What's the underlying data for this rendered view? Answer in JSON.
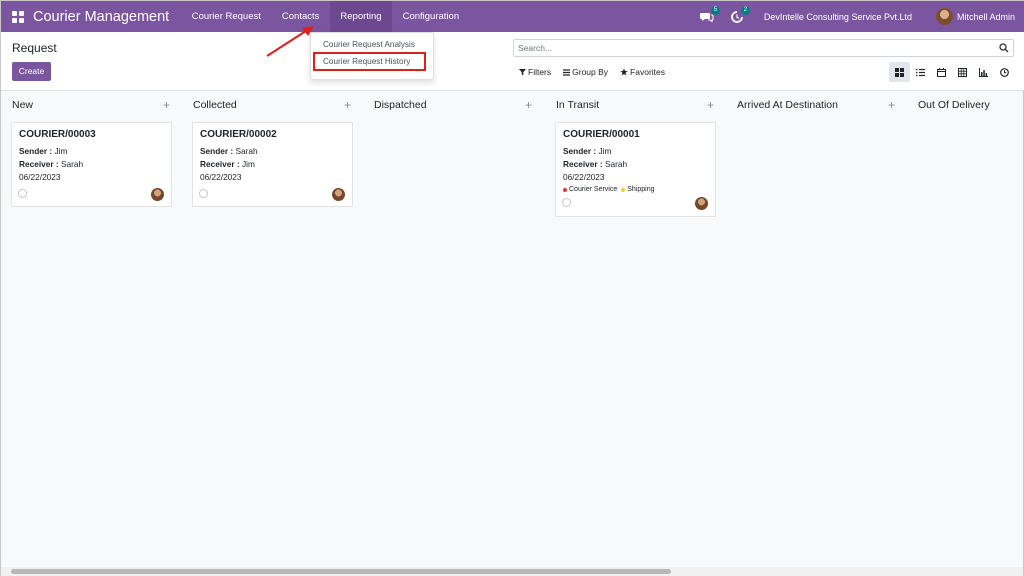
{
  "navbar": {
    "brand": "Courier Management",
    "menu": [
      "Courier Request",
      "Contacts",
      "Reporting",
      "Configuration"
    ],
    "messages_count": "5",
    "activities_count": "2",
    "company": "DevIntelle Consulting Service Pvt.Ltd",
    "user": "Mitchell Admin"
  },
  "dropdown": {
    "items": [
      "Courier Request Analysis",
      "Courier Request History"
    ]
  },
  "control": {
    "title": "Request",
    "create_label": "Create",
    "search_placeholder": "Search...",
    "filters_label": "Filters",
    "group_by_label": "Group By",
    "favorites_label": "Favorites"
  },
  "kanban": {
    "columns": [
      {
        "title": "New",
        "cards": [
          {
            "ref": "COURIER/00003",
            "sender_label": "Sender :",
            "sender": "Jim",
            "receiver_label": "Receiver :",
            "receiver": "Sarah",
            "date": "06/22/2023"
          }
        ]
      },
      {
        "title": "Collected",
        "cards": [
          {
            "ref": "COURIER/00002",
            "sender_label": "Sender :",
            "sender": "Sarah",
            "receiver_label": "Receiver :",
            "receiver": "Jim",
            "date": "06/22/2023"
          }
        ]
      },
      {
        "title": "Dispatched",
        "cards": []
      },
      {
        "title": "In Transit",
        "cards": [
          {
            "ref": "COURIER/00001",
            "sender_label": "Sender :",
            "sender": "Jim",
            "receiver_label": "Receiver :",
            "receiver": "Sarah",
            "date": "06/22/2023",
            "tags": [
              {
                "label": "Courier Service",
                "color": "#e53935"
              },
              {
                "label": "Shipping",
                "color": "#f4d41c"
              }
            ]
          }
        ]
      },
      {
        "title": "Arrived At Destination",
        "cards": []
      },
      {
        "title": "Out Of Delivery",
        "cards": []
      }
    ]
  },
  "colors": {
    "brand": "#7c55a1",
    "highlight_box": "#e01e1e",
    "badge": "#017e84"
  }
}
